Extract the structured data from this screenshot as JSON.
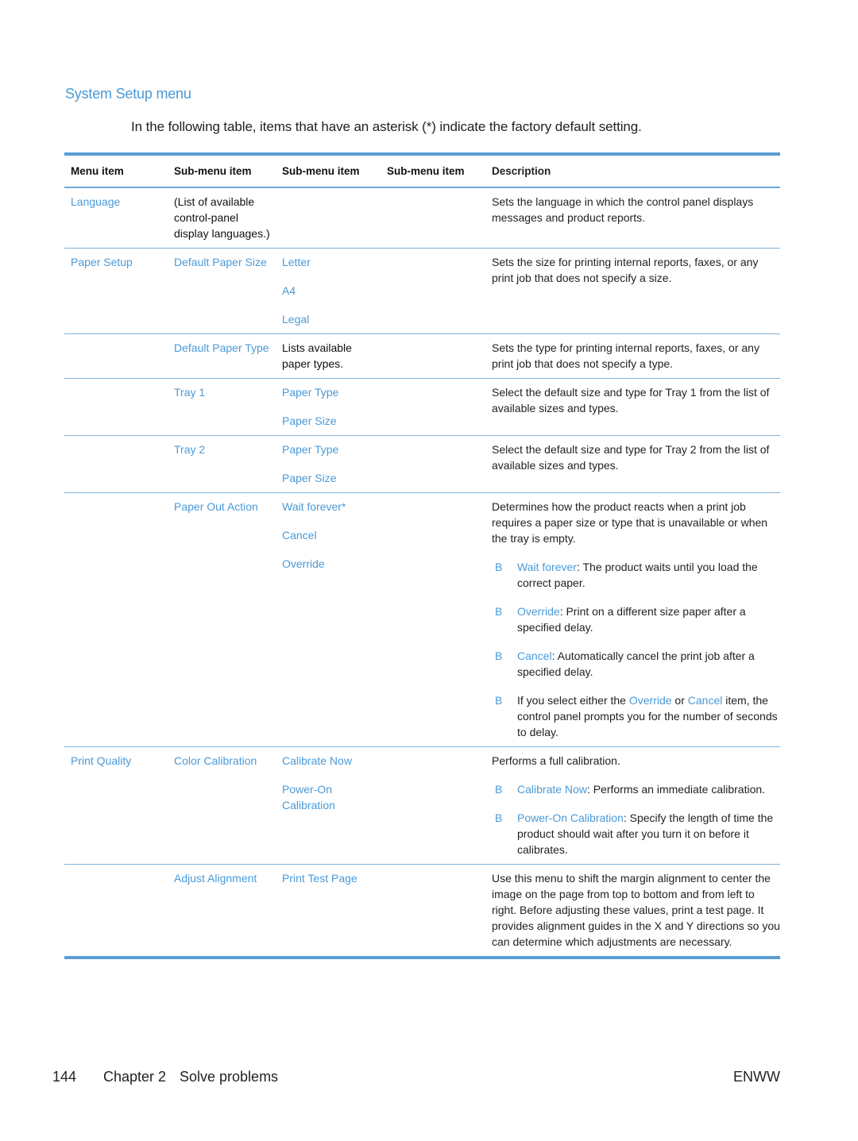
{
  "section_title": "System Setup menu",
  "intro": "In the following table, items that have an asterisk (*) indicate the factory default setting.",
  "table": {
    "headers": [
      "Menu item",
      "Sub-menu item",
      "Sub-menu item",
      "Sub-menu item",
      "Description"
    ],
    "bullet_marker": "B",
    "rows": {
      "language": {
        "menu": "Language",
        "sub1": "(List of available control-panel display languages.)",
        "desc": "Sets the language in which the control panel displays messages and product reports."
      },
      "paper_size": {
        "menu": "Paper Setup",
        "sub1": "Default Paper Size",
        "sub2": [
          "Letter",
          "A4",
          "Legal"
        ],
        "desc": "Sets the size for printing internal reports, faxes, or any print job that does not specify a size."
      },
      "paper_type": {
        "sub1": "Default Paper Type",
        "sub2": "Lists available paper types.",
        "desc": "Sets the type for printing internal reports, faxes, or any print job that does not specify a type."
      },
      "tray1": {
        "sub1": "Tray 1",
        "sub2": [
          "Paper Type",
          "Paper Size"
        ],
        "desc": "Select the default size and type for Tray 1 from the list of available sizes and types."
      },
      "tray2": {
        "sub1": "Tray 2",
        "sub2": [
          "Paper Type",
          "Paper Size"
        ],
        "desc": "Select the default size and type for Tray 2 from the list of available sizes and types."
      },
      "paper_out": {
        "sub1": "Paper Out Action",
        "sub2": [
          "Wait forever*",
          "Cancel",
          "Override"
        ],
        "desc": "Determines how the product reacts when a print job requires a paper size or type that is unavailable or when the tray is empty.",
        "bullets": [
          {
            "term": "Wait forever",
            "text": ": The product waits until you load the correct paper."
          },
          {
            "term": "Override",
            "text": ": Print on a different size paper after a specified delay."
          },
          {
            "term": "Cancel",
            "text": ": Automatically cancel the print job after a specified delay."
          }
        ],
        "last_bullet": {
          "pre": "If you select either the ",
          "term1": "Override",
          "mid": " or ",
          "term2": "Cancel",
          "post": " item, the control panel prompts you for the number of seconds to delay."
        }
      },
      "print_quality": {
        "menu": "Print Quality",
        "sub1": "Color Calibration",
        "sub2": [
          "Calibrate Now",
          "Power-On Calibration"
        ],
        "desc": "Performs a full calibration.",
        "bullets": [
          {
            "term": "Calibrate Now",
            "text": ": Performs an immediate calibration."
          },
          {
            "term": "Power-On Calibration",
            "text": ": Specify the length of time the product should wait after you turn it on before it calibrates."
          }
        ]
      },
      "alignment": {
        "sub1": "Adjust Alignment",
        "sub2": "Print Test Page",
        "desc": "Use this menu to shift the margin alignment to center the image on the page from top to bottom and from left to right. Before adjusting these values, print a test page. It provides alignment guides in the X and Y directions so you can determine which adjustments are necessary."
      }
    }
  },
  "footer": {
    "page_number": "144",
    "chapter": "Chapter 2",
    "chapter_title": "Solve problems",
    "code": "ENWW"
  }
}
